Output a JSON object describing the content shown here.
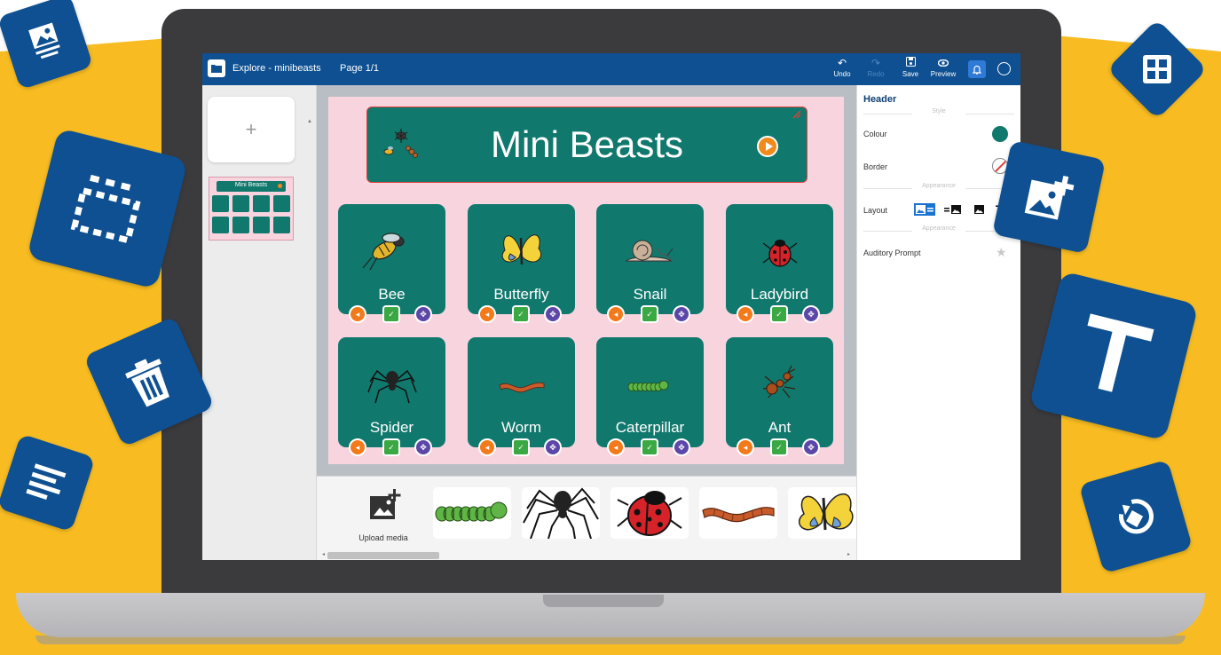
{
  "app": {
    "title": "Explore - minibeasts",
    "page_indicator": "Page 1/1"
  },
  "toolbar": {
    "undo_label": "Undo",
    "redo_label": "Redo",
    "save_label": "Save",
    "preview_label": "Preview"
  },
  "thumbnail": {
    "add_symbol": "+",
    "page_title": "Mini Beasts"
  },
  "header_card": {
    "title": "Mini Beasts"
  },
  "cards": [
    {
      "label": "Bee",
      "icon": "bee-icon"
    },
    {
      "label": "Butterfly",
      "icon": "butterfly-icon"
    },
    {
      "label": "Snail",
      "icon": "snail-icon"
    },
    {
      "label": "Ladybird",
      "icon": "ladybird-icon"
    },
    {
      "label": "Spider",
      "icon": "spider-icon"
    },
    {
      "label": "Worm",
      "icon": "worm-icon"
    },
    {
      "label": "Caterpillar",
      "icon": "caterpillar-icon"
    },
    {
      "label": "Ant",
      "icon": "ant-icon"
    }
  ],
  "media_bar": {
    "upload_label": "Upload media",
    "items": [
      "caterpillar-image",
      "spider-image",
      "ladybird-image",
      "worm-image",
      "butterfly-image"
    ]
  },
  "panel": {
    "title": "Header",
    "style_section": "Style",
    "colour_label": "Colour",
    "border_label": "Border",
    "appearance_section": "Appearance",
    "layout_label": "Layout",
    "appearance_section_2": "Appearance",
    "auditory_prompt_label": "Auditory Prompt"
  },
  "colors": {
    "brand_blue": "#0e5091",
    "card_teal": "#10786d",
    "page_pink": "#f8d5de",
    "accent_yellow": "#f8bc22",
    "audio_orange": "#f27a1b",
    "check_green": "#3aa843",
    "move_purple": "#5c47a8"
  }
}
